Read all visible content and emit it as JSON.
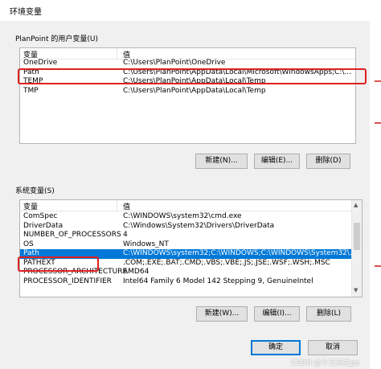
{
  "window": {
    "title": "环境变量"
  },
  "user_vars": {
    "group_label": "PlanPoint 的用户变量(U)",
    "columns": [
      "变量",
      "值"
    ],
    "rows": [
      {
        "name": "OneDrive",
        "value": "C:\\Users\\PlanPoint\\OneDrive"
      },
      {
        "name": "Path",
        "value": "C:\\Users\\PlanPoint\\AppData\\Local\\Microsoft\\WindowsApps;C:\\..."
      },
      {
        "name": "TEMP",
        "value": "C:\\Users\\PlanPoint\\AppData\\Local\\Temp"
      },
      {
        "name": "TMP",
        "value": "C:\\Users\\PlanPoint\\AppData\\Local\\Temp"
      }
    ],
    "buttons": {
      "new": "新建(N)...",
      "edit": "编辑(E)...",
      "delete": "删除(D)"
    }
  },
  "system_vars": {
    "group_label": "系统变量(S)",
    "columns": [
      "变量",
      "值"
    ],
    "rows": [
      {
        "name": "ComSpec",
        "value": "C:\\WINDOWS\\system32\\cmd.exe"
      },
      {
        "name": "DriverData",
        "value": "C:\\Windows\\System32\\Drivers\\DriverData"
      },
      {
        "name": "NUMBER_OF_PROCESSORS",
        "value": "4"
      },
      {
        "name": "OS",
        "value": "Windows_NT"
      },
      {
        "name": "Path",
        "value": "C:\\WINDOWS\\system32;C:\\WINDOWS;C:\\WINDOWS\\System32\\..."
      },
      {
        "name": "PATHEXT",
        "value": ".COM;.EXE;.BAT;.CMD;.VBS;.VBE;.JS;.JSE;.WSF;.WSH;.MSC"
      },
      {
        "name": "PROCESSOR_ARCHITECTURE",
        "value": "AMD64"
      },
      {
        "name": "PROCESSOR_IDENTIFIER",
        "value": "Intel64 Family 6 Model 142 Stepping 9, GenuineIntel"
      }
    ],
    "selected_index": 4,
    "buttons": {
      "new": "新建(W)...",
      "edit": "编辑(I)...",
      "delete": "删除(L)"
    }
  },
  "footer": {
    "ok": "确定",
    "cancel": "取消"
  },
  "watermark": "CSDN @十三先生po",
  "colors": {
    "selection": "#0078d7",
    "annotation": "#e02020"
  }
}
